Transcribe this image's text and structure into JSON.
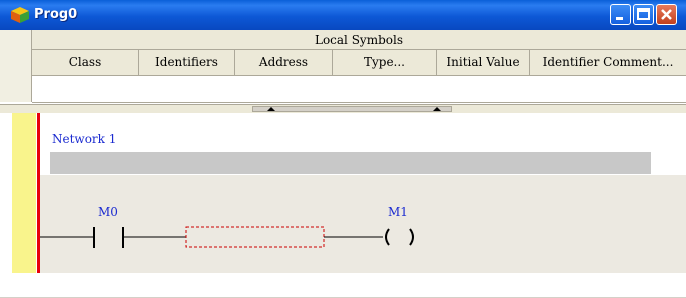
{
  "window": {
    "title": "Prog0",
    "buttons": [
      "minimize",
      "maximize",
      "close"
    ]
  },
  "symbols": {
    "group_title": "Local Symbols",
    "columns": [
      "Class",
      "Identifiers",
      "Address",
      "Type...",
      "Initial Value",
      "Identifier Comment..."
    ]
  },
  "ladder": {
    "network_label": "Network 1",
    "contact_operand": "M0",
    "coil_operand": "M1"
  },
  "colors": {
    "titlebar": "#0d58d6",
    "rail": "#e8000c",
    "margin": "#f9f48c",
    "operand_text": "#1b2bd0",
    "placeholder_border": "#cc0000"
  }
}
